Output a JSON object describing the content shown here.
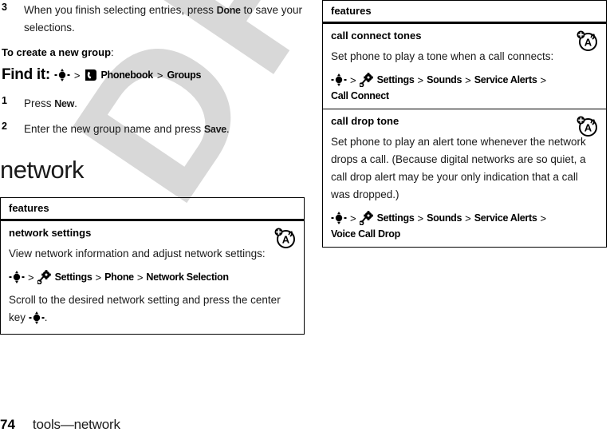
{
  "watermark": {
    "text": "DRAFT"
  },
  "footer": {
    "page_number": "74",
    "title": "tools—network"
  },
  "left_column": {
    "steps_top": [
      {
        "number": "3",
        "text_before": "When you finish selecting entries, press ",
        "bold": "Done",
        "text_after": " to save your selections."
      }
    ],
    "subhead": {
      "text": "To create a new group",
      "suffix": ":"
    },
    "find_it": {
      "label": "Find it:",
      "separator": ">",
      "items": [
        {
          "label": "Phonebook",
          "icon": "phonebook-icon"
        },
        {
          "label": "Groups",
          "icon": ""
        }
      ]
    },
    "steps_bottom": [
      {
        "number": "1",
        "text_before": "Press ",
        "bold": "New",
        "text_after": "."
      },
      {
        "number": "2",
        "text_before": "Enter the new group name and press ",
        "bold": "Save",
        "text_after": "."
      }
    ],
    "section_title": "network",
    "table": {
      "header": "features",
      "rows": [
        {
          "title": "network settings",
          "body": "View network information and adjust network settings:",
          "path": {
            "separator": ">",
            "items": [
              {
                "label": "Settings",
                "icon": "settings-gear-icon"
              },
              {
                "label": "Phone",
                "icon": ""
              },
              {
                "label": "Network Selection",
                "icon": ""
              }
            ]
          },
          "note": "Scroll to the desired network setting and press the center key",
          "note_suffix": ".",
          "icon": "alert-tone-icon"
        }
      ]
    }
  },
  "right_column": {
    "table": {
      "header": "features",
      "rows": [
        {
          "title": "call connect tones",
          "body": "Set phone to play a tone when a call connects:",
          "path": {
            "separator": ">",
            "items": [
              {
                "label": "Settings",
                "icon": "settings-gear-icon"
              },
              {
                "label": "Sounds",
                "icon": ""
              },
              {
                "label": "Service Alerts",
                "icon": ""
              },
              {
                "label": "Call Connect",
                "icon": ""
              }
            ]
          },
          "note": "",
          "icon": "alert-tone-icon"
        },
        {
          "title": "call drop tone",
          "body": "Set phone to play an alert tone whenever the network drops a call. (Because digital networks are so quiet, a call drop alert may be your only indication that a call was dropped.)",
          "path": {
            "separator": ">",
            "items": [
              {
                "label": "Settings",
                "icon": "settings-gear-icon"
              },
              {
                "label": "Sounds",
                "icon": ""
              },
              {
                "label": "Service Alerts",
                "icon": ""
              },
              {
                "label": "Voice Call Drop",
                "icon": ""
              }
            ]
          },
          "note": "",
          "icon": "alert-tone-icon"
        }
      ]
    }
  },
  "colors": {
    "text": "#1a1a1a",
    "rule": "#000000",
    "watermark": "#d8d8d8"
  }
}
